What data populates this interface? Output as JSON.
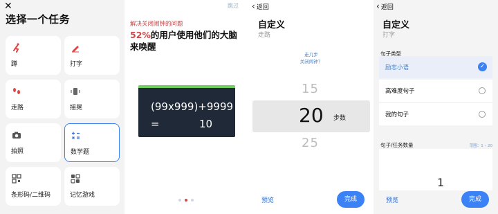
{
  "panel1": {
    "title": "选择一个任务",
    "close_icon": "close-icon",
    "tasks": [
      {
        "label": "蹲",
        "icon": "squat-icon"
      },
      {
        "label": "打字",
        "icon": "pencil-icon"
      },
      {
        "label": "走路",
        "icon": "footsteps-icon"
      },
      {
        "label": "摇晃",
        "icon": "shake-phone-icon"
      },
      {
        "label": "拍照",
        "icon": "camera-icon"
      },
      {
        "label": "数学题",
        "icon": "math-icon",
        "selected": true
      },
      {
        "label": "条形码/二维码",
        "icon": "qr-code-icon"
      },
      {
        "label": "记忆游戏",
        "icon": "memory-game-icon"
      }
    ]
  },
  "panel2": {
    "skip": "跳过",
    "subtitle": "解决关闭闹钟的问题",
    "headline_pct": "52%",
    "headline_rest": "的用户使用他们的大脑来唤醒",
    "math_expr": "(99x999)+9999",
    "math_eq": "=",
    "math_answer": "10",
    "pager_active": 2,
    "accent": "#d14848"
  },
  "panel3": {
    "back": "返回",
    "title": "自定义",
    "subtitle": "走路",
    "hint_line1": "走几步",
    "hint_line2": "关闭闹钟？",
    "picker_prev": "15",
    "picker_value": "20",
    "picker_unit": "步数",
    "picker_next": "25",
    "preview": "预览",
    "done": "完成"
  },
  "panel4": {
    "back": "返回",
    "title": "自定义",
    "subtitle": "打字",
    "sentence_type_label": "句子类型",
    "options": [
      {
        "label": "励志小语",
        "selected": true
      },
      {
        "label": "高难度句子",
        "selected": false
      },
      {
        "label": "我的句子",
        "selected": false
      }
    ],
    "count_label": "句子/任务数量",
    "range": "范围：1 – 20",
    "count_value": "1",
    "preview": "预览",
    "done": "完成",
    "accent": "#3b82f6"
  }
}
